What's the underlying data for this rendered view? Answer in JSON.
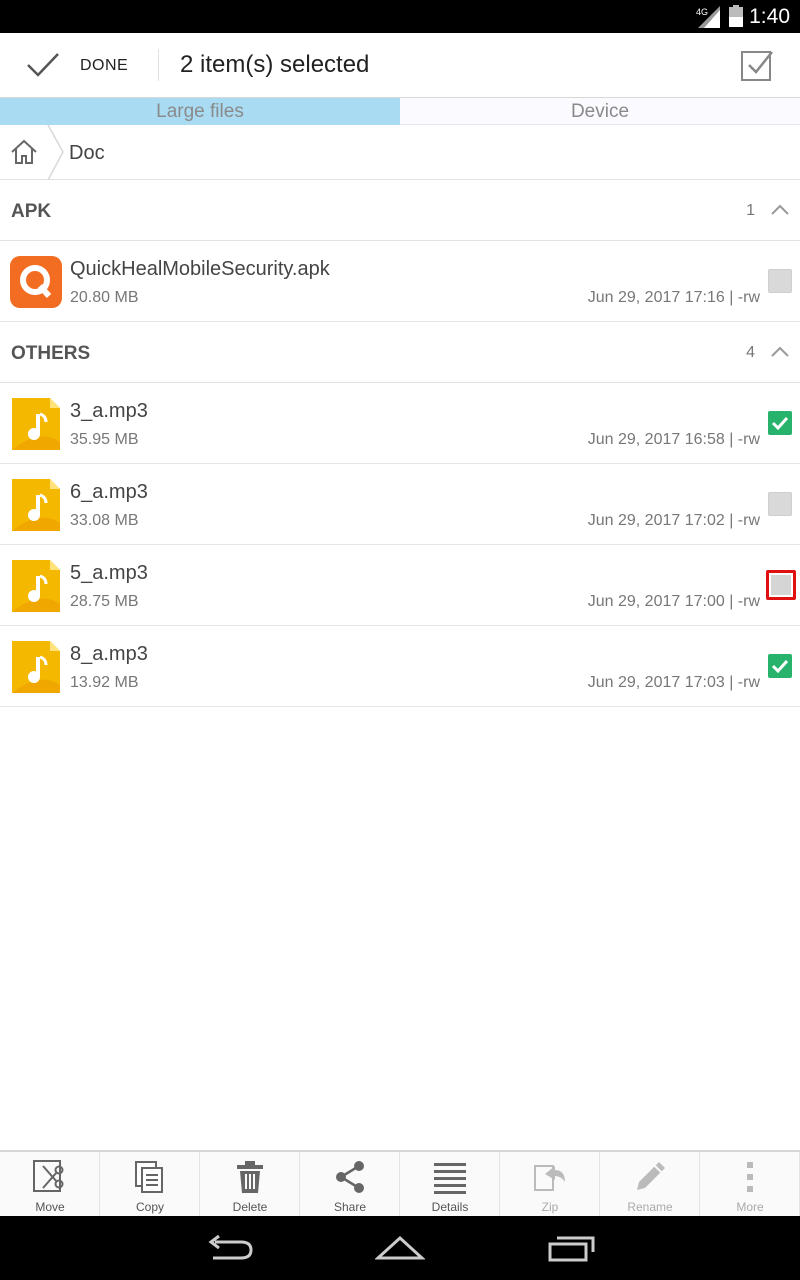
{
  "status": {
    "time": "1:40",
    "network": "4G"
  },
  "header": {
    "done_label": "DONE",
    "title": "2 item(s) selected"
  },
  "tabs": [
    {
      "label": "Large files",
      "active": true
    },
    {
      "label": "Device",
      "active": false
    }
  ],
  "breadcrumb": {
    "current": "Doc"
  },
  "sections": [
    {
      "name": "APK",
      "count": "1",
      "files": [
        {
          "name": "QuickHealMobileSecurity.apk",
          "size": "20.80 MB",
          "meta": "Jun 29, 2017 17:16 | -rw",
          "checked": false,
          "icon": "quickheal-app-icon"
        }
      ]
    },
    {
      "name": "OTHERS",
      "count": "4",
      "files": [
        {
          "name": "3_a.mp3",
          "size": "35.95 MB",
          "meta": "Jun 29, 2017 16:58 | -rw",
          "checked": true,
          "icon": "music-file-icon"
        },
        {
          "name": "6_a.mp3",
          "size": "33.08 MB",
          "meta": "Jun 29, 2017 17:02 | -rw",
          "checked": false,
          "icon": "music-file-icon"
        },
        {
          "name": "5_a.mp3",
          "size": "28.75 MB",
          "meta": "Jun 29, 2017 17:00 | -rw",
          "checked": false,
          "focused": true,
          "icon": "music-file-icon"
        },
        {
          "name": "8_a.mp3",
          "size": "13.92 MB",
          "meta": "Jun 29, 2017 17:03 | -rw",
          "checked": true,
          "icon": "music-file-icon"
        }
      ]
    }
  ],
  "toolbar": {
    "items": [
      {
        "label": "Move",
        "icon": "scissors-move-icon",
        "enabled": true
      },
      {
        "label": "Copy",
        "icon": "copy-icon",
        "enabled": true
      },
      {
        "label": "Delete",
        "icon": "trash-icon",
        "enabled": true
      },
      {
        "label": "Share",
        "icon": "share-icon",
        "enabled": true
      },
      {
        "label": "Details",
        "icon": "details-icon",
        "enabled": true
      },
      {
        "label": "Zip",
        "icon": "zip-icon",
        "enabled": false
      },
      {
        "label": "Rename",
        "icon": "pencil-icon",
        "enabled": false
      },
      {
        "label": "More",
        "icon": "more-vert-icon",
        "enabled": false
      }
    ]
  },
  "colors": {
    "tab_active": "#a9dcf3",
    "checked": "#27b36b",
    "focus_outline": "#e01010",
    "music_icon": "#f5b800",
    "apk_icon": "#f26d21"
  }
}
